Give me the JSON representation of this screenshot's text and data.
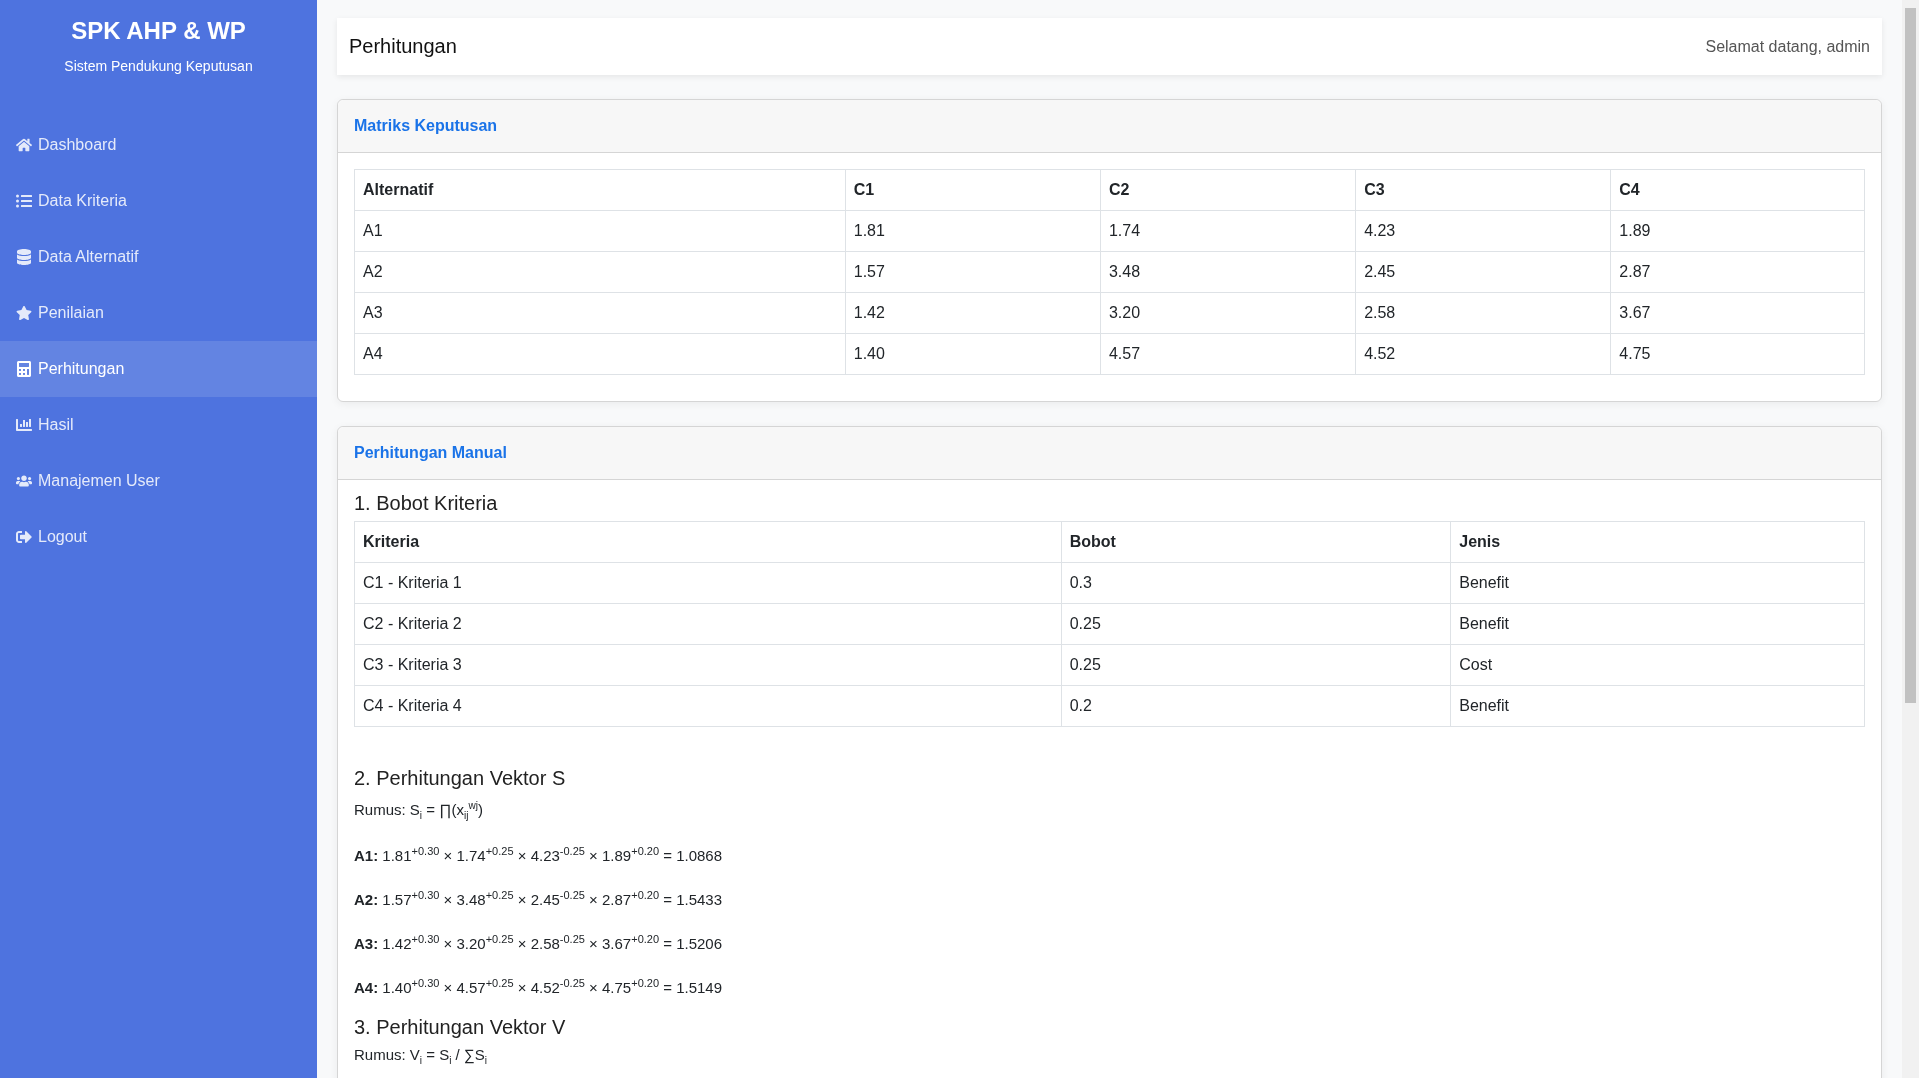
{
  "sidebar": {
    "title": "SPK AHP & WP",
    "subtitle": "Sistem Pendukung Keputusan",
    "items": [
      {
        "label": "Dashboard",
        "selected": false
      },
      {
        "label": "Data Kriteria",
        "selected": false
      },
      {
        "label": "Data Alternatif",
        "selected": false
      },
      {
        "label": "Penilaian",
        "selected": false
      },
      {
        "label": "Perhitungan",
        "selected": true
      },
      {
        "label": "Hasil",
        "selected": false
      },
      {
        "label": "Manajemen User",
        "selected": false
      },
      {
        "label": "Logout",
        "selected": false
      }
    ]
  },
  "header": {
    "title": "Perhitungan",
    "greeting": "Selamat datang, admin"
  },
  "decision_matrix": {
    "title": "Matriks Keputusan",
    "columns": [
      "Alternatif",
      "C1",
      "C2",
      "C3",
      "C4"
    ],
    "rows": [
      [
        "A1",
        "1.81",
        "1.74",
        "4.23",
        "1.89"
      ],
      [
        "A2",
        "1.57",
        "3.48",
        "2.45",
        "2.87"
      ],
      [
        "A3",
        "1.42",
        "3.20",
        "2.58",
        "3.67"
      ],
      [
        "A4",
        "1.40",
        "4.57",
        "4.52",
        "4.75"
      ]
    ]
  },
  "manual_calculation": {
    "title": "Perhitungan Manual",
    "sections": [
      {
        "kind": "table",
        "heading": "1. Bobot Kriteria",
        "columns": [
          "Kriteria",
          "Bobot",
          "Jenis"
        ],
        "rows": [
          [
            "C1 - Kriteria 1",
            "0.3",
            "Benefit"
          ],
          [
            "C2 - Kriteria 2",
            "0.25",
            "Benefit"
          ],
          [
            "C3 - Kriteria 3",
            "0.25",
            "Cost"
          ],
          [
            "C4 - Kriteria 4",
            "0.2",
            "Benefit"
          ]
        ]
      },
      {
        "kind": "formula",
        "heading": "2. Perhitungan Vektor S",
        "formula": "Rumus: S$_{i}$ = ∏(x$_{ij}$$^{wj}$)",
        "lines": [
          "**A1:** 1.81$^{+0.30}$ × 1.74$^{+0.25}$ × 4.23$^{-0.25}$ × 1.89$^{+0.20}$ = 1.0868",
          "**A2:** 1.57$^{+0.30}$ × 3.48$^{+0.25}$ × 2.45$^{-0.25}$ × 2.87$^{+0.20}$ = 1.5433",
          "**A3:** 1.42$^{+0.30}$ × 3.20$^{+0.25}$ × 2.58$^{-0.25}$ × 3.67$^{+0.20}$ = 1.5206",
          "**A4:** 1.40$^{+0.30}$ × 4.57$^{+0.25}$ × 4.52$^{-0.25}$ × 4.75$^{+0.20}$ = 1.5149"
        ]
      },
      {
        "kind": "formula",
        "heading": "3. Perhitungan Vektor V",
        "formula": "Rumus: V$_{i}$ = S$_{i}$ / ∑S$_{i}$"
      }
    ]
  }
}
